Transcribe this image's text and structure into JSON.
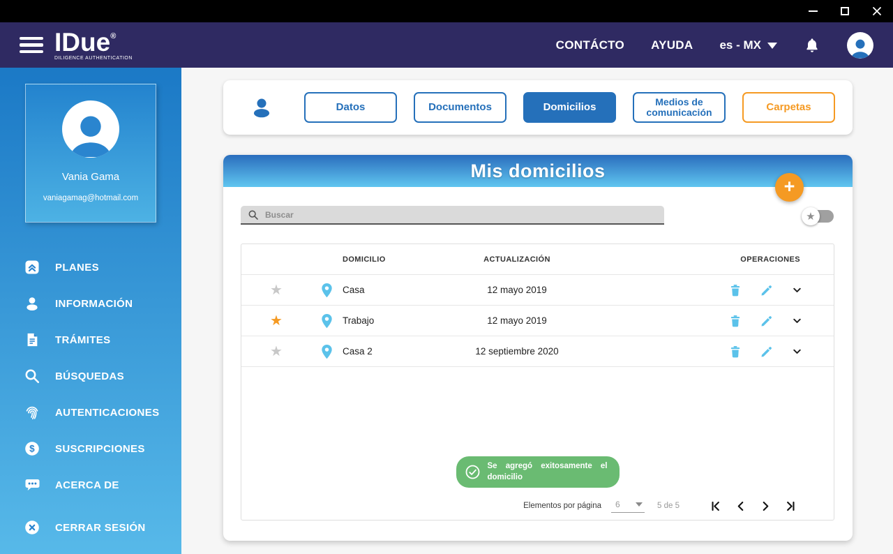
{
  "titlebar": {
    "controls": [
      "minimize-icon",
      "maximize-icon",
      "close-icon"
    ]
  },
  "navbar": {
    "logo": {
      "name": "IDue",
      "registered": "®",
      "tagline": "DILIGENCE AUTHENTICATION"
    },
    "contact_label": "CONTÁCTO",
    "help_label": "AYUDA",
    "language": "es - MX",
    "icons": [
      "bell-icon",
      "avatar-icon"
    ]
  },
  "sidebar": {
    "profile": {
      "name": "Vania Gama",
      "email": "vaniagamag@hotmail.com"
    },
    "items": [
      {
        "icon": "plans-icon",
        "label": "PLANES"
      },
      {
        "icon": "person-icon",
        "label": "INFORMACIÓN"
      },
      {
        "icon": "document-icon",
        "label": "TRÁMITES"
      },
      {
        "icon": "search-icon",
        "label": "BÚSQUEDAS"
      },
      {
        "icon": "fingerprint-icon",
        "label": "AUTENTICACIONES"
      },
      {
        "icon": "dollar-icon",
        "label": "SUSCRIPCIONES"
      },
      {
        "icon": "chat-icon",
        "label": "ACERCA DE"
      }
    ],
    "logout": {
      "icon": "logout-icon",
      "label": "CERRAR SESIÓN"
    }
  },
  "tabs": [
    {
      "label": "Datos",
      "active": false
    },
    {
      "label": "Documentos",
      "active": false
    },
    {
      "label": "Domicilios",
      "active": true
    },
    {
      "label": "Medios de comunicación",
      "active": false
    },
    {
      "label": "Carpetas",
      "active": false,
      "orange": true
    }
  ],
  "panel": {
    "title": "Mis domicilios",
    "add_button": "+",
    "search": {
      "placeholder": "Buscar",
      "value": ""
    }
  },
  "table": {
    "headers": {
      "domicilio": "DOMICILIO",
      "actualizacion": "ACTUALIZACIÓN",
      "operaciones": "OPERACIONES"
    },
    "rows": [
      {
        "favorite": false,
        "name": "Casa",
        "updated": "12 mayo 2019"
      },
      {
        "favorite": true,
        "name": "Trabajo",
        "updated": "12 mayo 2019"
      },
      {
        "favorite": false,
        "name": "Casa 2",
        "updated": "12 septiembre 2020"
      }
    ]
  },
  "toast": {
    "message": "Se agregó exitosamente el domicilio"
  },
  "pagination": {
    "label": "Elementos por página",
    "per_page": "6",
    "range": "5 de 5"
  },
  "colors": {
    "accent_blue": "#2570ba",
    "light_blue": "#5bc2ea",
    "orange": "#f59a23",
    "green": "#6abb72",
    "navbar": "#2f2a62",
    "sidebar_top": "#1b79c6",
    "sidebar_bottom": "#57b9e9"
  }
}
